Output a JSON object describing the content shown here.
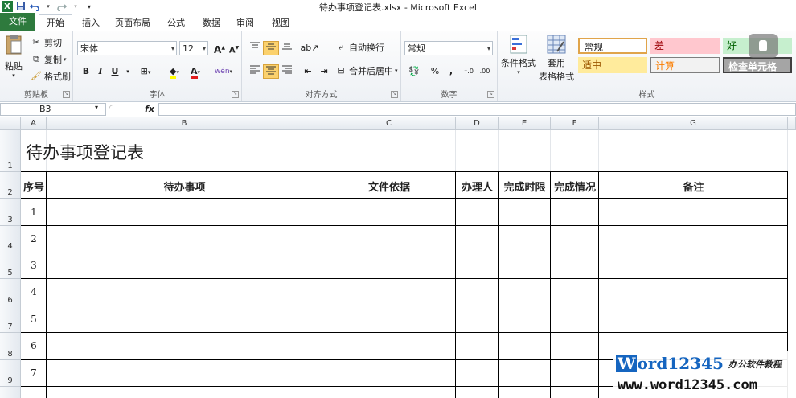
{
  "window": {
    "title": "待办事项登记表.xlsx - Microsoft Excel"
  },
  "qat": {
    "excel_logo": "X"
  },
  "tabs": [
    {
      "label": "文件"
    },
    {
      "label": "开始"
    },
    {
      "label": "插入"
    },
    {
      "label": "页面布局"
    },
    {
      "label": "公式"
    },
    {
      "label": "数据"
    },
    {
      "label": "审阅"
    },
    {
      "label": "视图"
    }
  ],
  "ribbon": {
    "clipboard": {
      "paste": "粘贴",
      "cut": "剪切",
      "copy": "复制",
      "format_painter": "格式刷",
      "label": "剪贴板"
    },
    "font": {
      "name": "宋体",
      "size": "12",
      "bold": "B",
      "italic": "I",
      "underline": "U",
      "grow": "A",
      "shrink": "A",
      "font_color": "A",
      "phonetic": "wén",
      "label": "字体"
    },
    "alignment": {
      "wrap": "自动换行",
      "merge": "合并后居中",
      "label": "对齐方式"
    },
    "number": {
      "format": "常规",
      "percent": "%",
      "comma": ",",
      "label": "数字"
    },
    "styles": {
      "conditional": "条件格式",
      "table_format_1": "套用",
      "table_format_2": "表格格式",
      "cells": [
        {
          "text": "常规",
          "bg": "#ffffff",
          "color": "#222222",
          "border": "#e0a44a"
        },
        {
          "text": "差",
          "bg": "#ffc7ce",
          "color": "#9c0006",
          "border": "#ffc7ce"
        },
        {
          "text": "好",
          "bg": "#c6efce",
          "color": "#006100",
          "border": "#c6efce"
        },
        {
          "text": "适中",
          "bg": "#ffeb9c",
          "color": "#9c5700",
          "border": "#ffeb9c"
        },
        {
          "text": "计算",
          "bg": "#f2f2f2",
          "color": "#fa7d00",
          "border": "#7f7f7f"
        },
        {
          "text": "检查单元格",
          "bg": "#a5a5a5",
          "color": "#ffffff",
          "border": "#3f3f3f"
        }
      ],
      "label": "样式"
    }
  },
  "formula_bar": {
    "name_box": "B3",
    "fx": "fx",
    "value": ""
  },
  "columns": [
    "A",
    "B",
    "C",
    "D",
    "E",
    "F",
    "G"
  ],
  "rows": [
    "1",
    "2",
    "3",
    "4",
    "5",
    "6",
    "7",
    "8",
    "9"
  ],
  "sheet": {
    "title": "待办事项登记表",
    "headers": [
      "序号",
      "待办事项",
      "文件依据",
      "办理人",
      "完成时限",
      "完成情况",
      "备注"
    ],
    "numbers": [
      "1",
      "2",
      "3",
      "4",
      "5",
      "6",
      "7"
    ]
  },
  "watermark": {
    "brand_w": "W",
    "brand_rest": "ord12345",
    "tagline": "办公软件教程",
    "url": "www.word12345.com"
  }
}
